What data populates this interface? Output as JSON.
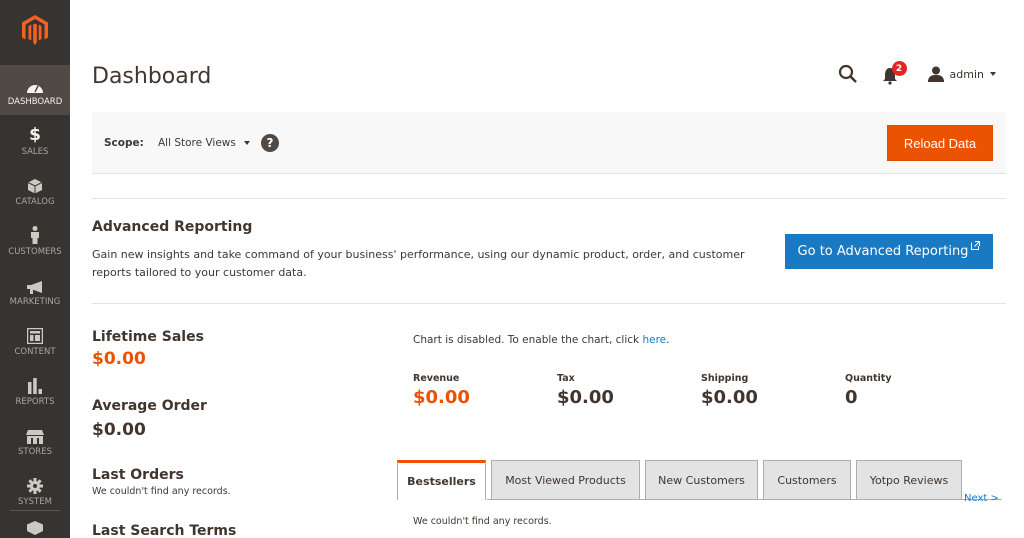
{
  "sidebar": {
    "logo": "magento-logo",
    "items": [
      {
        "label": "Dashboard",
        "icon": "dashboard-icon",
        "active": true
      },
      {
        "label": "Sales",
        "icon": "dollar-icon",
        "active": false
      },
      {
        "label": "Catalog",
        "icon": "box-icon",
        "active": false
      },
      {
        "label": "Customers",
        "icon": "person-icon",
        "active": false
      },
      {
        "label": "Marketing",
        "icon": "megaphone-icon",
        "active": false
      },
      {
        "label": "Content",
        "icon": "layout-icon",
        "active": false
      },
      {
        "label": "Reports",
        "icon": "bar-chart-icon",
        "active": false
      },
      {
        "label": "Stores",
        "icon": "storefront-icon",
        "active": false
      },
      {
        "label": "System",
        "icon": "gear-icon",
        "active": false
      }
    ],
    "extra_icon": "extensions-icon"
  },
  "header": {
    "title": "Dashboard",
    "notifications_count": "2",
    "user": "admin"
  },
  "scope": {
    "label": "Scope:",
    "selected": "All Store Views",
    "help": "?",
    "reload_button": "Reload Data"
  },
  "advanced_reporting": {
    "title": "Advanced Reporting",
    "description": "Gain new insights and take command of your business' performance, using our dynamic product, order, and customer reports tailored to your customer data.",
    "button": "Go to Advanced Reporting",
    "button_icon": "external-link-icon"
  },
  "stats": {
    "lifetime_sales_label": "Lifetime Sales",
    "lifetime_sales_value": "$0.00",
    "average_order_label": "Average Order",
    "average_order_value": "$0.00",
    "last_orders_label": "Last Orders",
    "last_orders_note": "We couldn't find any records.",
    "last_search_terms_label": "Last Search Terms"
  },
  "chart": {
    "message": "Chart is disabled. To enable the chart, click ",
    "link": "here",
    "suffix": "."
  },
  "totals": [
    {
      "label": "Revenue",
      "value": "$0.00"
    },
    {
      "label": "Tax",
      "value": "$0.00"
    },
    {
      "label": "Shipping",
      "value": "$0.00"
    },
    {
      "label": "Quantity",
      "value": "0"
    }
  ],
  "tabs": [
    {
      "label": "Bestsellers",
      "active": true
    },
    {
      "label": "Most Viewed Products",
      "active": false
    },
    {
      "label": "New Customers",
      "active": false
    },
    {
      "label": "Customers",
      "active": false
    },
    {
      "label": "Yotpo Reviews",
      "active": false
    }
  ],
  "next_link": "Next >",
  "tab_content": "We couldn't find any records.",
  "colors": {
    "accent": "#eb5202",
    "link": "#1979c3",
    "sidebar_bg": "#373330",
    "sidebar_active": "#514943",
    "badge": "#e22626"
  }
}
